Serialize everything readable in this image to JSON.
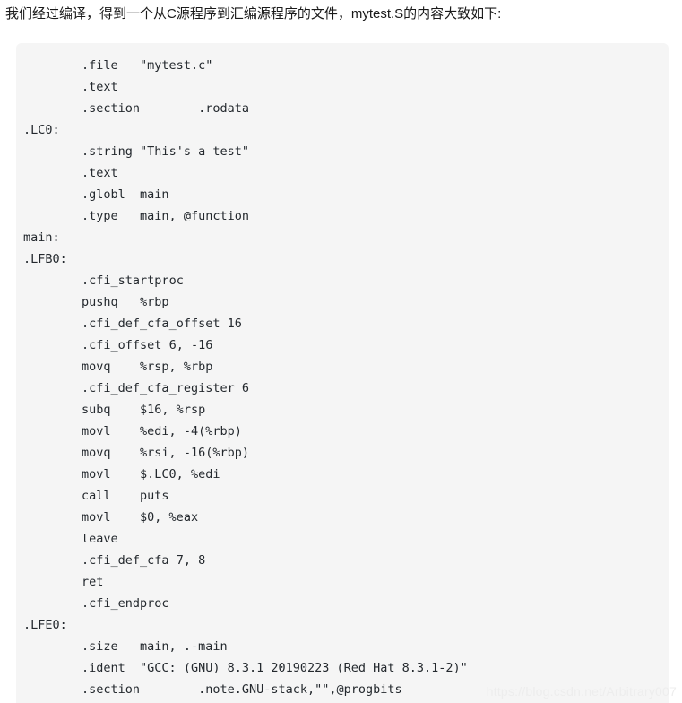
{
  "page": {
    "background_color": "#ffffff",
    "intro_paragraph": "我们经过编译，得到一个从C源程序到汇编源程序的文件，mytest.S的内容大致如下:"
  },
  "code_block": {
    "background_color": "#f5f5f5",
    "text_color": "#24292e",
    "language": "assembly",
    "filename_described": "mytest.S",
    "lines": [
      "\t.file\t\"mytest.c\"",
      "\t.text",
      "\t.section\t.rodata",
      ".LC0:",
      "\t.string \"This's a test\"",
      "\t.text",
      "\t.globl\tmain",
      "\t.type\tmain, @function",
      "main:",
      ".LFB0:",
      "\t.cfi_startproc",
      "\tpushq\t%rbp",
      "\t.cfi_def_cfa_offset 16",
      "\t.cfi_offset 6, -16",
      "\tmovq\t%rsp, %rbp",
      "\t.cfi_def_cfa_register 6",
      "\tsubq\t$16, %rsp",
      "\tmovl\t%edi, -4(%rbp)",
      "\tmovq\t%rsi, -16(%rbp)",
      "\tmovl\t$.LC0, %edi",
      "\tcall\tputs",
      "\tmovl\t$0, %eax",
      "\tleave",
      "\t.cfi_def_cfa 7, 8",
      "\tret",
      "\t.cfi_endproc",
      ".LFE0:",
      "\t.size\tmain, .-main",
      "\t.ident\t\"GCC: (GNU) 8.3.1 20190223 (Red Hat 8.3.1-2)\"",
      "\t.section\t.note.GNU-stack,\"\",@progbits"
    ]
  },
  "watermark": {
    "text": "https://blog.csdn.net/Arbitrary007",
    "color": "#ededed"
  }
}
